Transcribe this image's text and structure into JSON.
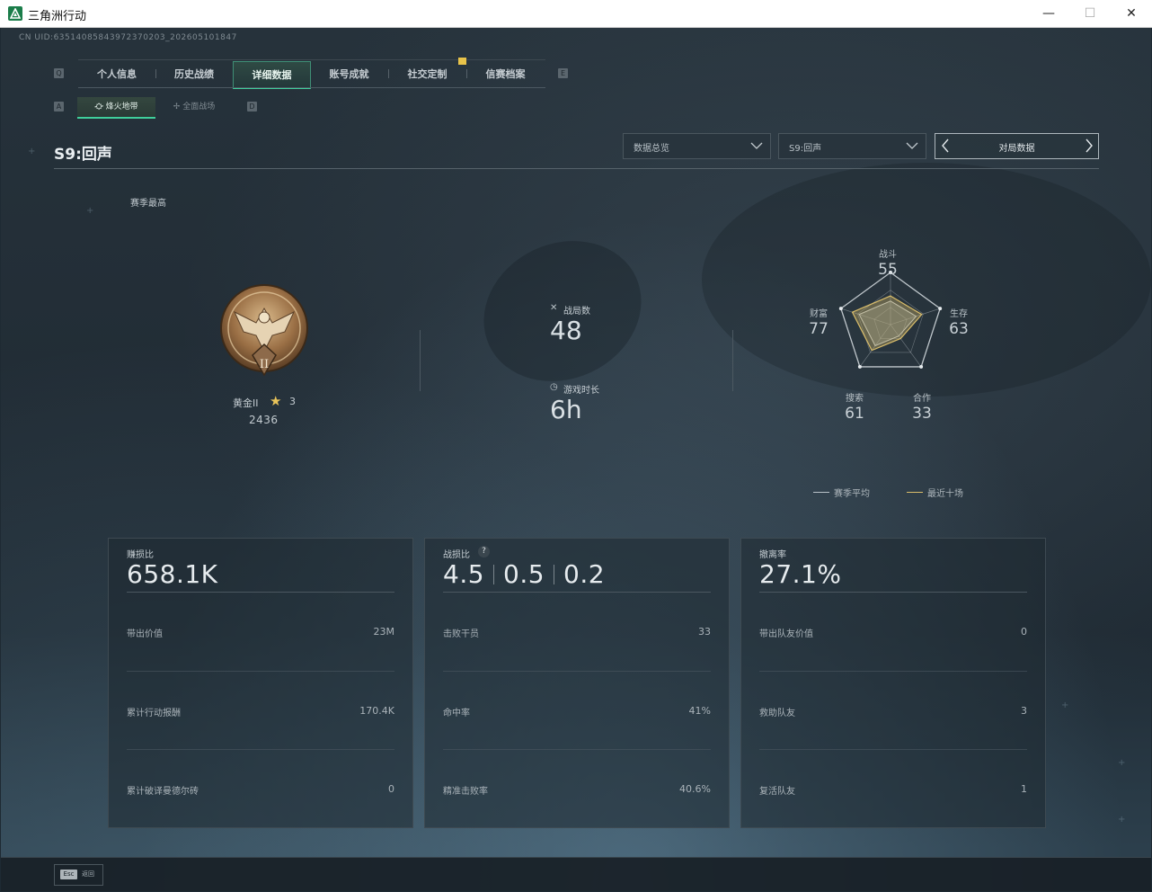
{
  "window": {
    "title": "三角洲行动",
    "minimize": "—",
    "maximize": "☐",
    "close": "✕"
  },
  "uid": "CN UID:63514085843972370203_202605101847",
  "tabs": {
    "left_key": "Q",
    "right_key": "E",
    "items": [
      {
        "label": "个人信息"
      },
      {
        "label": "历史战绩"
      },
      {
        "label": "详细数据",
        "active": true
      },
      {
        "label": "账号成就"
      },
      {
        "label": "社交定制"
      },
      {
        "label": "信赛档案"
      }
    ]
  },
  "subtabs": {
    "left_key": "A",
    "right_key": "D",
    "items": [
      {
        "label": "烽火地带",
        "active": true
      },
      {
        "label": "全面战场"
      }
    ]
  },
  "season": {
    "title": "S9:回声",
    "dropdown_view": "数据总览",
    "dropdown_season": "S9:回声",
    "nav_label": "对局数据",
    "best_label": "赛季最高"
  },
  "rank": {
    "name": "黄金II",
    "stars": "3",
    "score": "2436"
  },
  "stats": {
    "matches_label": "战局数",
    "matches_value": "48",
    "playtime_label": "游戏时长",
    "playtime_value": "6h"
  },
  "radar": {
    "axes": [
      {
        "label": "战斗",
        "value": "55"
      },
      {
        "label": "生存",
        "value": "63"
      },
      {
        "label": "合作",
        "value": "33"
      },
      {
        "label": "搜索",
        "value": "61"
      },
      {
        "label": "财富",
        "value": "77"
      }
    ],
    "legend": [
      {
        "label": "赛季平均",
        "color": "#b9c2c8"
      },
      {
        "label": "最近十场",
        "color": "#d9bd6a"
      }
    ]
  },
  "panels": [
    {
      "title": "赚损比",
      "big": "658.1K",
      "rows": [
        {
          "label": "带出价值",
          "value": "23M"
        },
        {
          "label": "累计行动报酬",
          "value": "170.4K"
        },
        {
          "label": "累计破译曼德尔砖",
          "value": "0"
        }
      ]
    },
    {
      "title": "战损比",
      "big_values": [
        "4.5",
        "0.5",
        "0.2"
      ],
      "help": "?",
      "rows": [
        {
          "label": "击败干员",
          "value": "33"
        },
        {
          "label": "命中率",
          "value": "41%"
        },
        {
          "label": "精准击败率",
          "value": "40.6%"
        }
      ]
    },
    {
      "title": "撤离率",
      "big": "27.1%",
      "rows": [
        {
          "label": "带出队友价值",
          "value": "0"
        },
        {
          "label": "救助队友",
          "value": "3"
        },
        {
          "label": "复活队友",
          "value": "1"
        }
      ]
    }
  ],
  "footer": {
    "esc_key": "Esc",
    "esc_label": "返回"
  }
}
